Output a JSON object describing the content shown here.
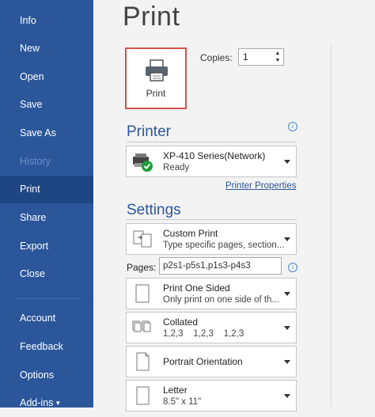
{
  "sidebar": {
    "items": [
      {
        "label": "Info"
      },
      {
        "label": "New"
      },
      {
        "label": "Open"
      },
      {
        "label": "Save"
      },
      {
        "label": "Save As"
      },
      {
        "label": "History"
      },
      {
        "label": "Print"
      },
      {
        "label": "Share"
      },
      {
        "label": "Export"
      },
      {
        "label": "Close"
      },
      {
        "label": "Account"
      },
      {
        "label": "Feedback"
      },
      {
        "label": "Options"
      },
      {
        "label": "Add-ins"
      }
    ],
    "active": "Print",
    "disabled": "History",
    "color": "#2b579a"
  },
  "main": {
    "title": "Print",
    "print_button_label": "Print",
    "copies_label": "Copies:",
    "copies_value": "1",
    "printer_heading": "Printer",
    "printer": {
      "name": "XP-410 Series(Network)",
      "status": "Ready",
      "icon": "printer-ready-icon"
    },
    "printer_properties": "Printer Properties",
    "settings_heading": "Settings",
    "settings": [
      {
        "title": "Custom Print",
        "subtitle": "Type specific pages, section..."
      },
      {
        "title": "Print One Sided",
        "subtitle": "Only print on one side of th..."
      },
      {
        "title": "Collated",
        "subtitle": "1,2,3    1,2,3    1,2,3"
      },
      {
        "title": "Portrait Orientation",
        "subtitle": ""
      },
      {
        "title": "Letter",
        "subtitle": "8.5\" x 11\""
      }
    ],
    "pages_label": "Pages:",
    "pages_value": "p2s1-p5s1,p1s3-p4s3",
    "info_icon": "i",
    "accent": "#d4524d"
  }
}
